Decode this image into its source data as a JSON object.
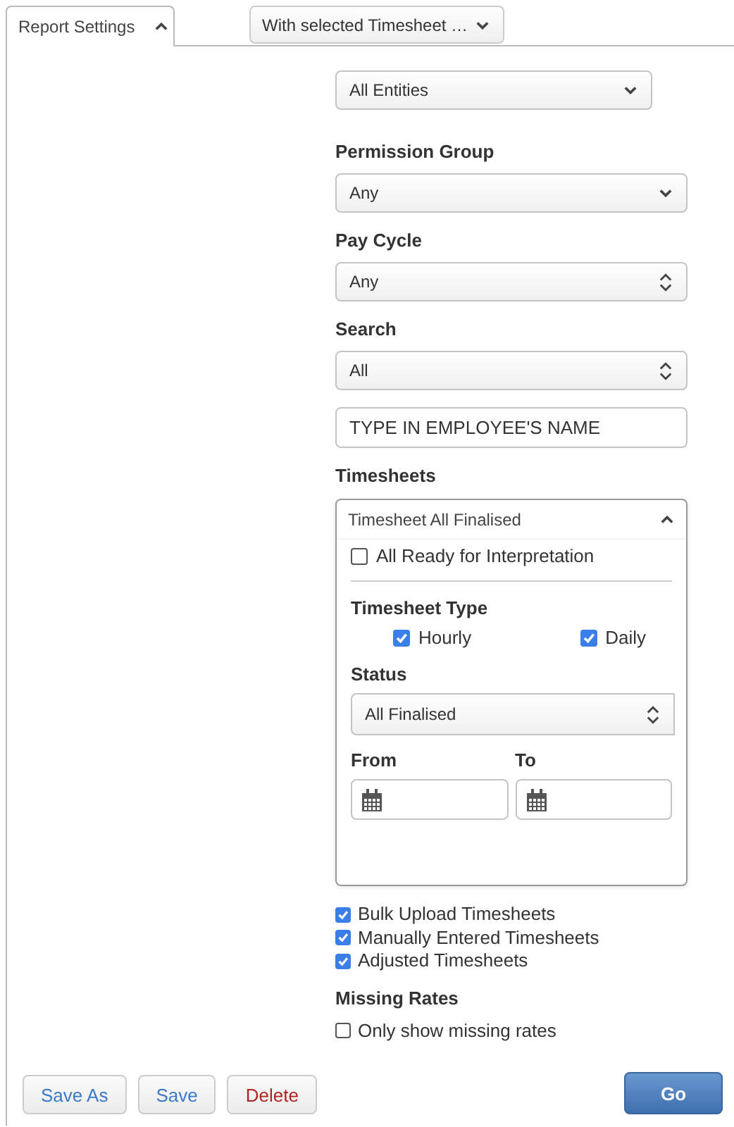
{
  "tab": {
    "label": "Report Settings",
    "selected": true,
    "expanded": true
  },
  "actions_menu": {
    "label": "With selected Timesheet …"
  },
  "fields": [
    {
      "kind": "select",
      "value": "All Entities",
      "narrow": true
    },
    {
      "kind": "select",
      "label": "Permission Group",
      "value": "Any"
    },
    {
      "kind": "stepper",
      "label": "Pay Cycle",
      "value": "Any"
    },
    {
      "kind": "stepper",
      "label": "Search",
      "value": "All"
    },
    {
      "kind": "text",
      "value": "TYPE IN EMPLOYEE'S NAME"
    }
  ],
  "timesheets": {
    "label": "Timesheets",
    "summary": "Timesheet All Finalised",
    "expanded": true,
    "ready": {
      "label": "All Ready for Interpretation",
      "checked": false
    },
    "type_label": "Timesheet Type",
    "types": [
      {
        "label": "Hourly",
        "checked": true
      },
      {
        "label": "Daily",
        "checked": true
      }
    ],
    "status_label": "Status",
    "status": "All Finalised",
    "from_label": "From",
    "to_label": "To"
  },
  "includes": [
    {
      "label": "Bulk Upload Timesheets",
      "checked": true
    },
    {
      "label": "Manually Entered Timesheets",
      "checked": true
    },
    {
      "label": "Adjusted Timesheets",
      "checked": true
    }
  ],
  "missing_rates": {
    "label": "Missing Rates",
    "option": {
      "label": "Only show missing rates",
      "checked": false
    }
  },
  "buttons": [
    {
      "label": "Save As",
      "kind": "default"
    },
    {
      "label": "Save",
      "kind": "default"
    },
    {
      "label": "Delete",
      "kind": "danger"
    },
    {
      "label": "Go",
      "kind": "primary"
    }
  ]
}
